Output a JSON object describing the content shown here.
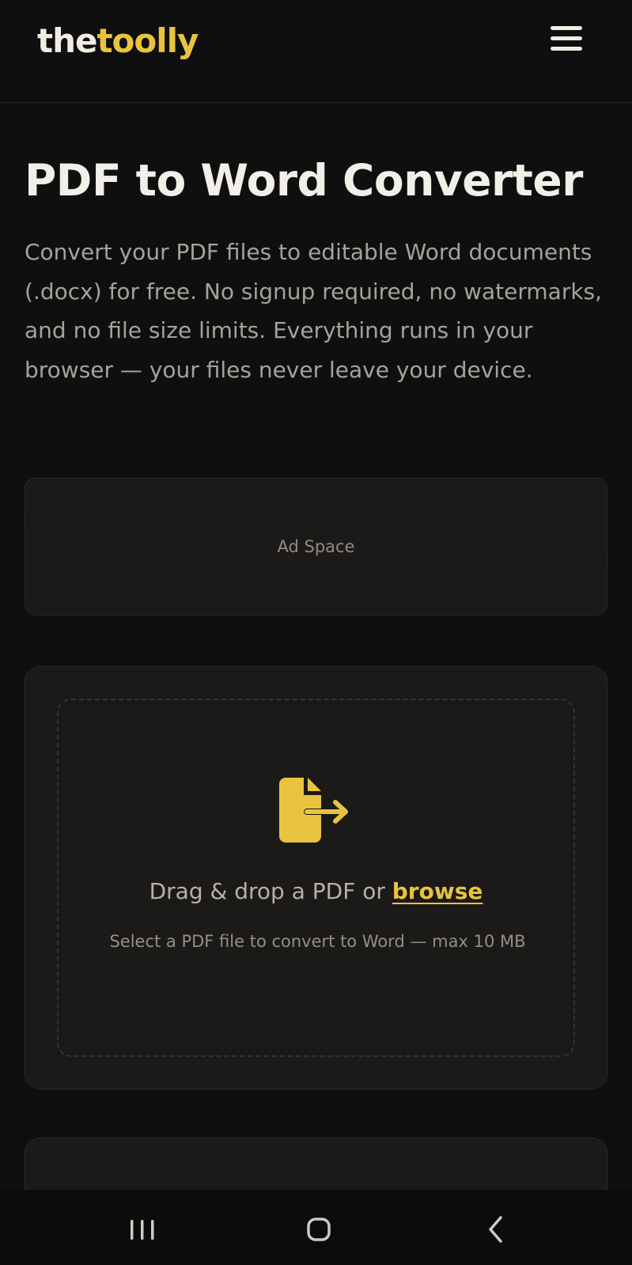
{
  "header": {
    "logo_part1": "the",
    "logo_part2": "toolly",
    "menu_icon": "hamburger-menu-icon"
  },
  "page": {
    "title": "PDF to Word Converter",
    "intro": "Convert your PDF files to editable Word documents (.docx) for free. No signup required, no watermarks, and no file size limits. Everything runs in your browser — your files never leave your device."
  },
  "ad": {
    "label": "Ad Space"
  },
  "upload": {
    "icon": "file-export-icon",
    "prompt": "Drag & drop a PDF or",
    "browse_label": "browse",
    "hint": "Select a PDF file to convert to Word — max 10 MB"
  },
  "system_nav": {
    "recents_icon": "recent-apps-icon",
    "home_icon": "home-icon",
    "back_icon": "back-icon"
  },
  "colors": {
    "accent": "#e8c33d",
    "background": "#0f0f0f",
    "card": "#1b1a18"
  }
}
